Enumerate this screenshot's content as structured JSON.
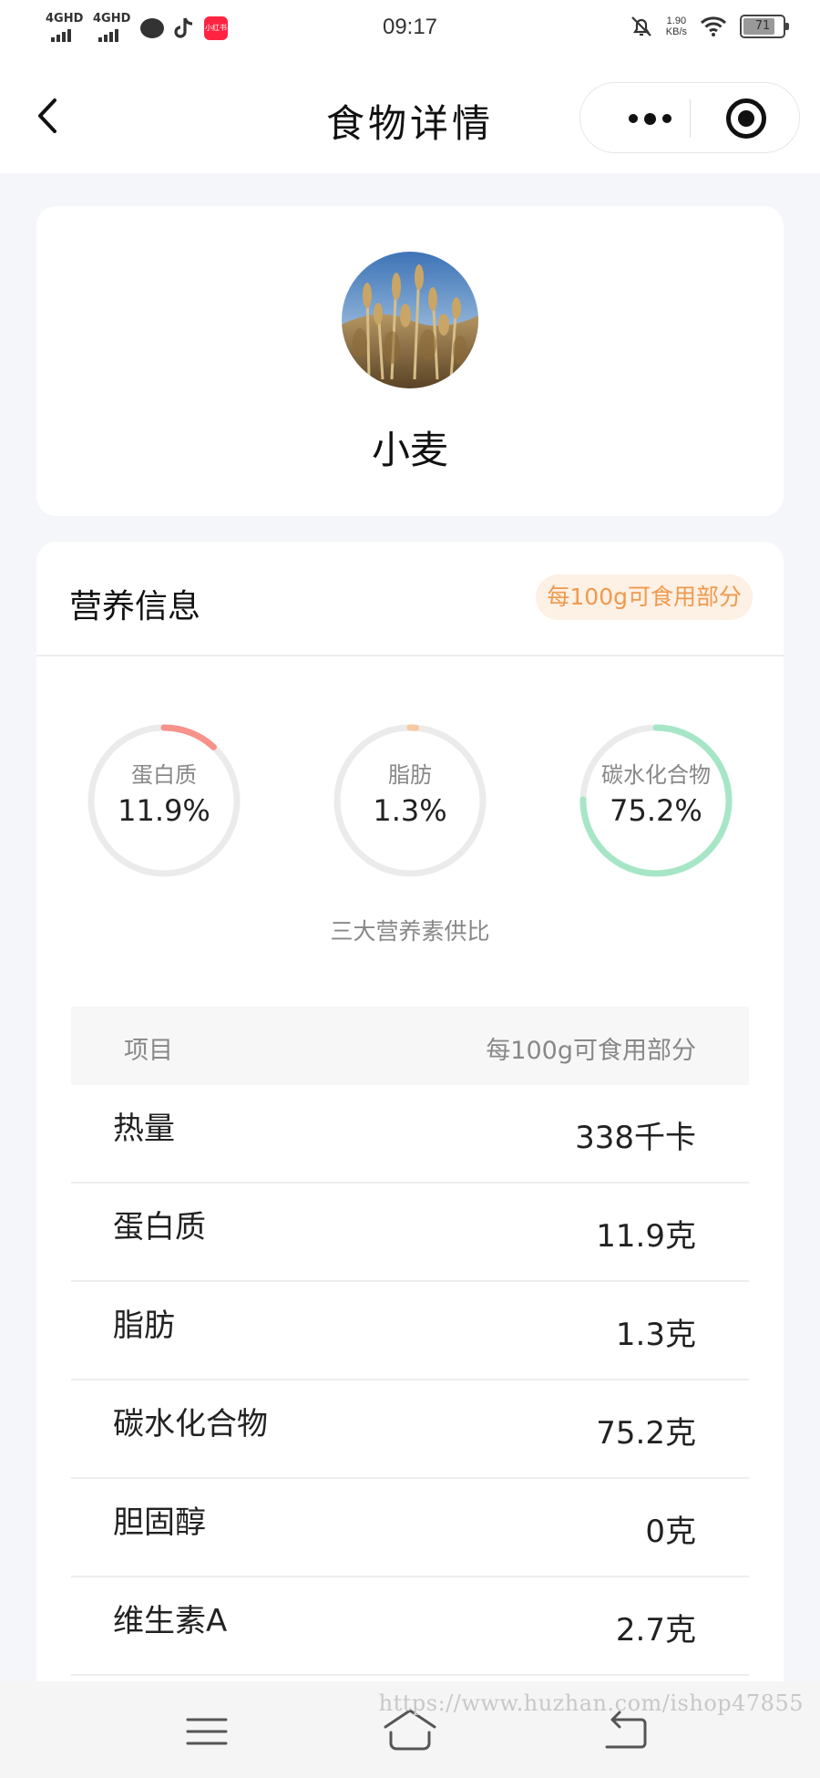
{
  "status_bar": {
    "network_1": "4GHD",
    "network_2": "4GHD",
    "app_badge": "小红书",
    "time": "09:17",
    "speed_value": "1.90",
    "speed_unit": "KB/s",
    "battery": "71",
    "icons": [
      "signal-icon",
      "chat-icon",
      "tiktok-icon",
      "xiaohongshu-icon",
      "mute-bell-icon",
      "wifi-icon",
      "battery-icon"
    ]
  },
  "nav": {
    "title": "食物详情",
    "back_icon": "chevron-left-icon",
    "more_icon": "more-dots-icon",
    "close_icon": "target-circle-icon"
  },
  "food": {
    "name": "小麦",
    "image": "wheat-photo"
  },
  "nutrition": {
    "title": "营养信息",
    "badge": "每100g可食用部分",
    "rings": [
      {
        "label": "蛋白质",
        "value_text": "11.9%",
        "percent": 11.9,
        "color": "#f7928b"
      },
      {
        "label": "脂肪",
        "value_text": "1.3%",
        "percent": 1.3,
        "color": "#f8c9a0"
      },
      {
        "label": "碳水化合物",
        "value_text": "75.2%",
        "percent": 75.2,
        "color": "#a6e6c6"
      }
    ],
    "ring_track_color": "#ebebeb",
    "ring_caption": "三大营养素供比",
    "table": {
      "header_item": "项目",
      "header_value": "每100g可食用部分",
      "rows": [
        {
          "name": "热量",
          "value": "338千卡"
        },
        {
          "name": "蛋白质",
          "value": "11.9克"
        },
        {
          "name": "脂肪",
          "value": "1.3克"
        },
        {
          "name": "碳水化合物",
          "value": "75.2克"
        },
        {
          "name": "胆固醇",
          "value": "0克"
        },
        {
          "name": "维生素A",
          "value": "2.7克"
        }
      ]
    }
  },
  "bottom_nav": {
    "icons": [
      "menu-icon",
      "home-icon",
      "back-return-icon"
    ]
  },
  "watermark": "https://www.huzhan.com/ishop47855"
}
